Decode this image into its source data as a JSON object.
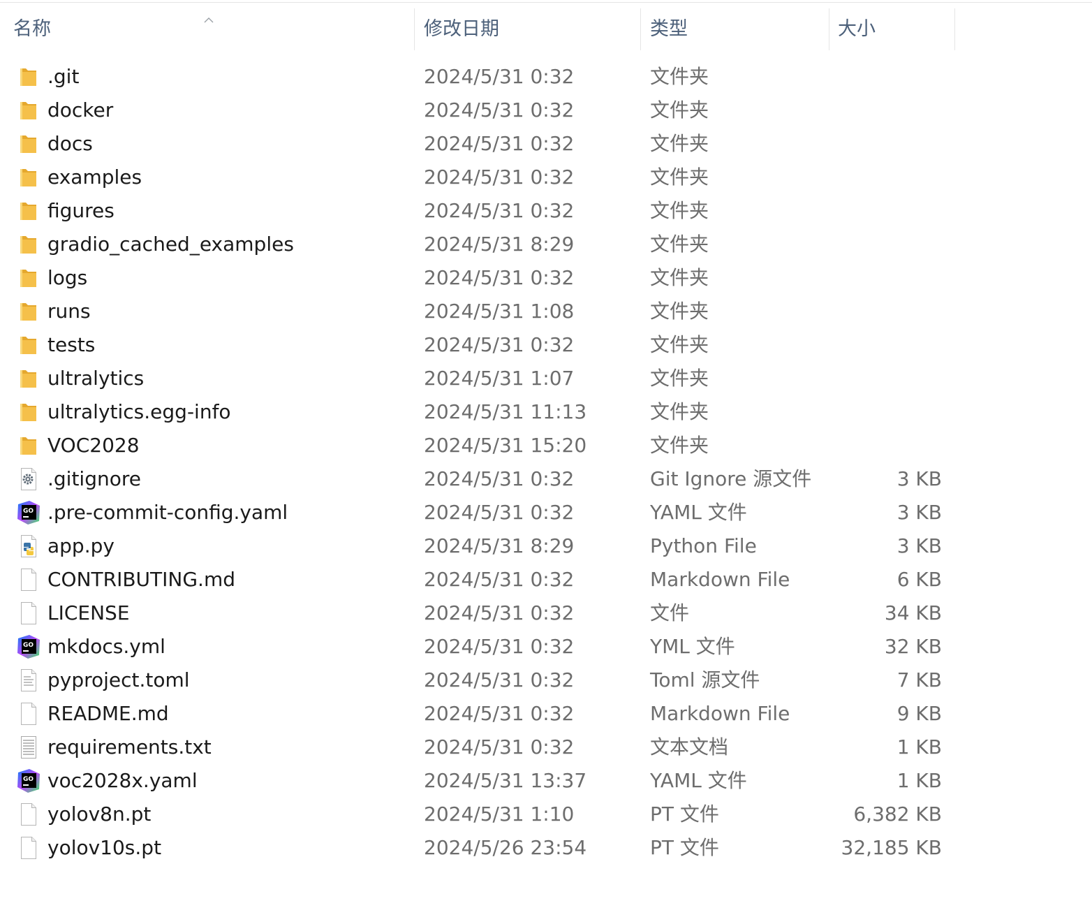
{
  "columns": {
    "name": "名称",
    "modified": "修改日期",
    "type": "类型",
    "size": "大小"
  },
  "sort": {
    "column": "name",
    "direction": "ascending"
  },
  "colors": {
    "header_text": "#4c607a",
    "name_text": "#1a1a1a",
    "detail_text": "#6d6d6d",
    "folder": "#f5c04a"
  },
  "files": [
    {
      "name": ".git",
      "modified": "2024/5/31 0:32",
      "type": "文件夹",
      "size": "",
      "icon": "folder-icon"
    },
    {
      "name": "docker",
      "modified": "2024/5/31 0:32",
      "type": "文件夹",
      "size": "",
      "icon": "folder-icon"
    },
    {
      "name": "docs",
      "modified": "2024/5/31 0:32",
      "type": "文件夹",
      "size": "",
      "icon": "folder-icon"
    },
    {
      "name": "examples",
      "modified": "2024/5/31 0:32",
      "type": "文件夹",
      "size": "",
      "icon": "folder-icon"
    },
    {
      "name": "figures",
      "modified": "2024/5/31 0:32",
      "type": "文件夹",
      "size": "",
      "icon": "folder-icon"
    },
    {
      "name": "gradio_cached_examples",
      "modified": "2024/5/31 8:29",
      "type": "文件夹",
      "size": "",
      "icon": "folder-icon"
    },
    {
      "name": "logs",
      "modified": "2024/5/31 0:32",
      "type": "文件夹",
      "size": "",
      "icon": "folder-icon"
    },
    {
      "name": "runs",
      "modified": "2024/5/31 1:08",
      "type": "文件夹",
      "size": "",
      "icon": "folder-icon"
    },
    {
      "name": "tests",
      "modified": "2024/5/31 0:32",
      "type": "文件夹",
      "size": "",
      "icon": "folder-icon"
    },
    {
      "name": "ultralytics",
      "modified": "2024/5/31 1:07",
      "type": "文件夹",
      "size": "",
      "icon": "folder-icon"
    },
    {
      "name": "ultralytics.egg-info",
      "modified": "2024/5/31 11:13",
      "type": "文件夹",
      "size": "",
      "icon": "folder-icon"
    },
    {
      "name": "VOC2028",
      "modified": "2024/5/31 15:20",
      "type": "文件夹",
      "size": "",
      "icon": "folder-icon"
    },
    {
      "name": ".gitignore",
      "modified": "2024/5/31 0:32",
      "type": "Git Ignore 源文件",
      "size": "3 KB",
      "icon": "gear-file-icon"
    },
    {
      "name": ".pre-commit-config.yaml",
      "modified": "2024/5/31 0:32",
      "type": "YAML 文件",
      "size": "3 KB",
      "icon": "goland-icon"
    },
    {
      "name": "app.py",
      "modified": "2024/5/31 8:29",
      "type": "Python File",
      "size": "3 KB",
      "icon": "python-file-icon"
    },
    {
      "name": "CONTRIBUTING.md",
      "modified": "2024/5/31 0:32",
      "type": "Markdown File",
      "size": "6 KB",
      "icon": "blank-file-icon"
    },
    {
      "name": "LICENSE",
      "modified": "2024/5/31 0:32",
      "type": "文件",
      "size": "34 KB",
      "icon": "blank-file-icon"
    },
    {
      "name": "mkdocs.yml",
      "modified": "2024/5/31 0:32",
      "type": "YML 文件",
      "size": "32 KB",
      "icon": "goland-icon"
    },
    {
      "name": "pyproject.toml",
      "modified": "2024/5/31 0:32",
      "type": "Toml 源文件",
      "size": "7 KB",
      "icon": "text-file-icon"
    },
    {
      "name": "README.md",
      "modified": "2024/5/31 0:32",
      "type": "Markdown File",
      "size": "9 KB",
      "icon": "blank-file-icon"
    },
    {
      "name": "requirements.txt",
      "modified": "2024/5/31 0:32",
      "type": "文本文档",
      "size": "1 KB",
      "icon": "lined-file-icon"
    },
    {
      "name": "voc2028x.yaml",
      "modified": "2024/5/31 13:37",
      "type": "YAML 文件",
      "size": "1 KB",
      "icon": "goland-icon"
    },
    {
      "name": "yolov8n.pt",
      "modified": "2024/5/31 1:10",
      "type": "PT 文件",
      "size": "6,382 KB",
      "icon": "blank-file-icon"
    },
    {
      "name": "yolov10s.pt",
      "modified": "2024/5/26 23:54",
      "type": "PT 文件",
      "size": "32,185 KB",
      "icon": "blank-file-icon"
    }
  ]
}
